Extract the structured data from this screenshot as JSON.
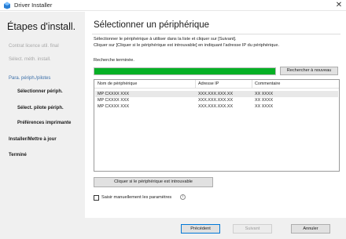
{
  "window": {
    "title": "Driver Installer",
    "close_glyph": "✕",
    "app_icon": "installer-icon"
  },
  "sidebar": {
    "heading": "Étapes d'install.",
    "steps": [
      {
        "label": "Contrat licence util. final",
        "state": "done"
      },
      {
        "label": "Sélect. méth. install.",
        "state": "done"
      },
      {
        "label": "Para. périph./pilotes",
        "state": "parent"
      },
      {
        "label": "Sélectionner périph.",
        "state": "current"
      },
      {
        "label": "Sélect. pilote périph.",
        "state": "pending"
      },
      {
        "label": "Préférences imprimante",
        "state": "pending"
      },
      {
        "label": "Installer/Mettre à jour",
        "state": "pending"
      },
      {
        "label": "Terminé",
        "state": "pending"
      }
    ]
  },
  "main": {
    "title": "Sélectionner un périphérique",
    "instructions": [
      "Sélectionner le périphérique à utiliser dans la liste et cliquer sur [Suivant].",
      "Cliquer sur [Cliquer si le périphérique est introuvable] en indiquant l'adresse IP du périphérique."
    ],
    "status": "Recherche terminée.",
    "progress_fraction": 1.0,
    "refresh_label": "Rechercher à nouveau",
    "table": {
      "headers": [
        "Nom de périphérique",
        "Adresse IP",
        "Commentaire"
      ],
      "rows": [
        [
          "MP CXXXX XXX",
          "XXX.XXX.XXX.XX",
          "XX XXXX"
        ],
        [
          "MP CXXXX XXX",
          "XXX.XXX.XXX.XX",
          "XX XXXX"
        ],
        [
          "MP CXXXX XXX",
          "XXX.XXX.XXX.XX",
          "XX XXXX"
        ]
      ],
      "selected_row": 0
    },
    "not_found_label": "Cliquer si le périphérique est introuvable",
    "manual_params_label": "Saisir manuellement les paramètres",
    "manual_params_checked": false,
    "info_glyph": "i"
  },
  "footer": {
    "prev_label": "Précédent",
    "next_label": "Suivant",
    "cancel_label": "Annuler"
  },
  "colors": {
    "progress": "#06b025",
    "accent": "#0078d7",
    "sidebar_bg": "#f0f0f0",
    "step_parent": "#3a6ea8"
  }
}
